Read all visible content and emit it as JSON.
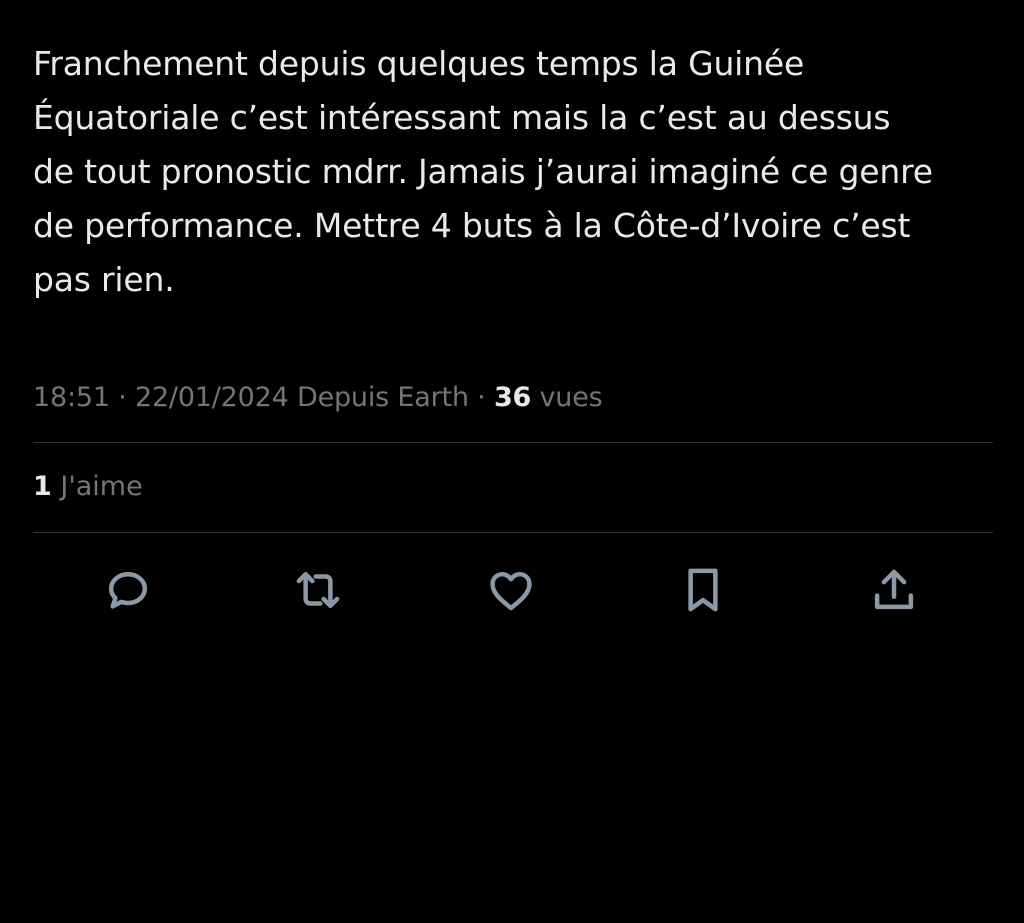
{
  "tweet": {
    "text": "Franchement depuis quelques temps la Guinée\nÉquatoriale c’est intéressant mais la c’est au dessus\nde tout pronostic mdrr. Jamais j’aurai imaginé ce genre\nde performance. Mettre 4 buts à la Côte-d’Ivoire c’est\npas rien.",
    "meta": {
      "time": "18:51",
      "separator1": " · ",
      "date": "22/01/2024",
      "source": " Depuis Earth",
      "separator2": " · ",
      "views_count": "36",
      "views_label": " vues"
    },
    "likes": {
      "count": "1",
      "label": " J'aime"
    }
  },
  "actions": {
    "reply_icon": "reply-icon",
    "retweet_icon": "retweet-icon",
    "like_icon": "heart-icon",
    "bookmark_icon": "bookmark-icon",
    "share_icon": "share-icon"
  },
  "colors": {
    "background": "#000000",
    "primary_text": "#e7e9ea",
    "secondary_text": "#71767b",
    "divider": "#2f3336",
    "icon": "#8b98a5"
  }
}
